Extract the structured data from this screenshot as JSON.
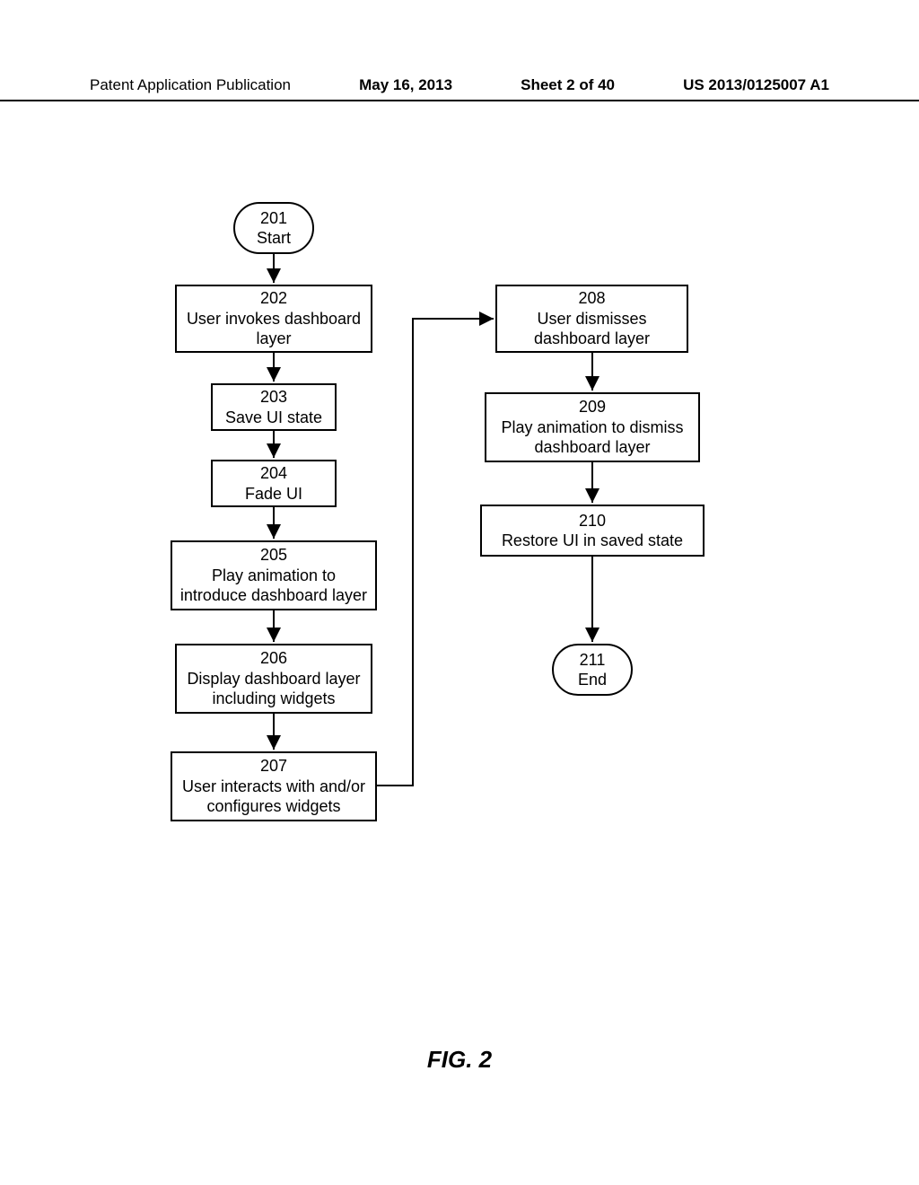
{
  "header": {
    "left": "Patent Application Publication",
    "date": "May 16, 2013",
    "sheet": "Sheet 2 of 40",
    "pubno": "US 2013/0125007 A1"
  },
  "nodes": {
    "n201": {
      "num": "201",
      "text": "Start"
    },
    "n202": {
      "num": "202",
      "text": "User invokes dashboard layer"
    },
    "n203": {
      "num": "203",
      "text": "Save UI state"
    },
    "n204": {
      "num": "204",
      "text": "Fade UI"
    },
    "n205": {
      "num": "205",
      "text": "Play animation to introduce dashboard layer"
    },
    "n206": {
      "num": "206",
      "text": "Display dashboard layer including widgets"
    },
    "n207": {
      "num": "207",
      "text": "User interacts with and/or configures widgets"
    },
    "n208": {
      "num": "208",
      "text": "User dismisses dashboard layer"
    },
    "n209": {
      "num": "209",
      "text": "Play animation to dismiss dashboard layer"
    },
    "n210": {
      "num": "210",
      "text": "Restore UI in saved state"
    },
    "n211": {
      "num": "211",
      "text": "End"
    }
  },
  "figure_label": "FIG. 2"
}
